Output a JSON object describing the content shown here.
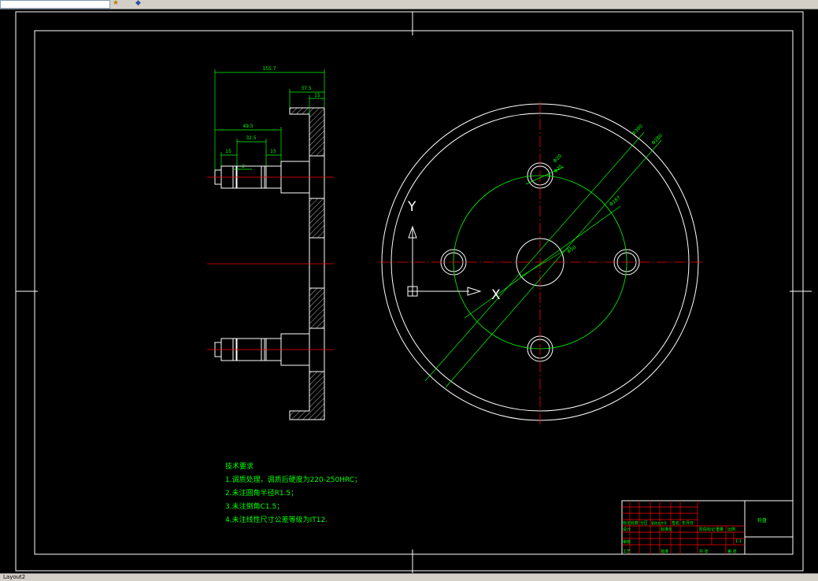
{
  "toolbar": {
    "icons": [
      "layer-icon",
      "gear-icon"
    ]
  },
  "colors": {
    "background": "#000000",
    "frame": "#ffffff",
    "geometry": "#ffffff",
    "dimension": "#00ff00",
    "centerline": "#ff0000",
    "title_block": "#ff0000",
    "notes": "#00ff00"
  },
  "side_view": {
    "dimensions": {
      "overall": "155.7",
      "flange": "37.5",
      "flange_small": "15",
      "shaft_len": "49.5",
      "shaft_mid": "32.5",
      "step_left": "15",
      "step_right": "15",
      "groove": "2"
    }
  },
  "front_view": {
    "dimensions": {
      "outer_d": "Φ300",
      "ring_d": "Φ280",
      "hole_small": "Φ20",
      "hole_ring": "Φ25",
      "pitch_d": "Φ187",
      "center_hole": "Φ50"
    },
    "ucs": {
      "x_label": "X",
      "y_label": "Y"
    }
  },
  "notes": {
    "title": "技术要求",
    "items": [
      "1.调质处理，调质后硬度为220-250HRC；",
      "2.未注圆角半径R1.5；",
      "3.未注倒角C1.5；",
      "4.未注线性尺寸公差等级为IT12."
    ]
  },
  "title_block": {
    "part_name": "轮盘",
    "labels": {
      "marker": "标记",
      "count": "处数",
      "zone": "分区",
      "change_doc": "更改文件号",
      "signature": "签名",
      "date": "年月日",
      "design": "设计",
      "standardize": "标准化",
      "stage_mark": "阶段标记",
      "weight": "重量",
      "scale": "比例",
      "scale_value": "1:1",
      "review": "审核",
      "process": "工艺",
      "approve": "批准",
      "sheets": "共 张",
      "sheet": "第 张"
    }
  },
  "status": {
    "text": "Layout2"
  }
}
